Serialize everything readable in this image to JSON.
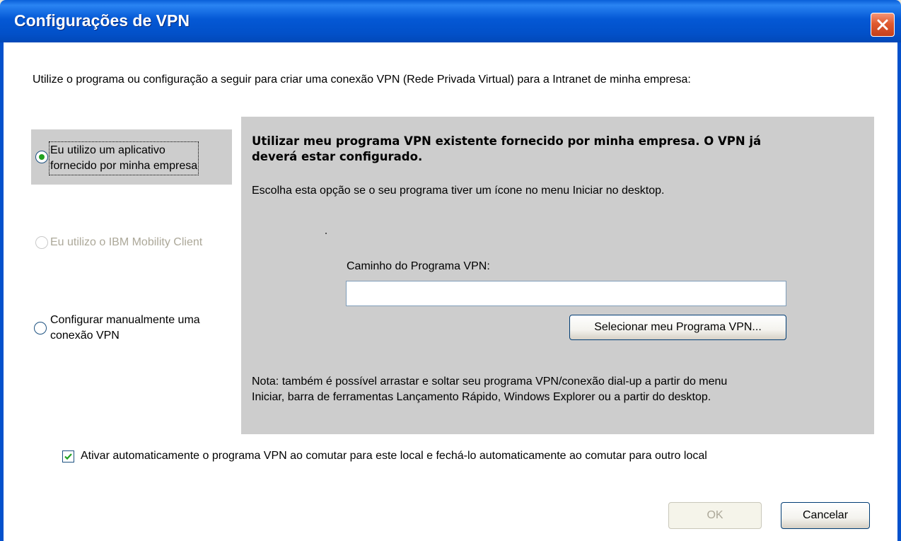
{
  "window": {
    "title": "Configurações de VPN"
  },
  "intro_text": "Utilize o programa ou configuração a seguir para criar uma conexão VPN (Rede Privada Virtual) para a Intranet de minha empresa:",
  "options": [
    {
      "line1": "Eu utilizo um aplicativo",
      "line2": "fornecido por minha empresa",
      "selected": true,
      "enabled": true
    },
    {
      "line1": "Eu utilizo o IBM Mobility Client",
      "line2": "",
      "selected": false,
      "enabled": false
    },
    {
      "line1": "Configurar manualmente uma",
      "line2": "conexão VPN",
      "selected": false,
      "enabled": true
    }
  ],
  "panel": {
    "heading_line1": "Utilizar meu programa VPN existente fornecido por minha empresa.  O VPN já",
    "heading_line2": "deverá estar configurado.",
    "description": "Escolha esta opção se o seu programa tiver um ícone no menu Iniciar no desktop.",
    "path_label": "Caminho do Programa VPN:",
    "path_value": "",
    "select_button": "Selecionar meu Programa VPN...",
    "note_line1": "Nota: também é possível arrastar e soltar seu programa VPN/conexão dial-up a partir do menu",
    "note_line2": "Iniciar, barra de ferramentas Lançamento Rápido, Windows Explorer ou a partir do desktop."
  },
  "auto_activate": {
    "checked": true,
    "label": "Ativar automaticamente o programa VPN ao comutar para este local e fechá-lo automaticamente ao comutar para outro local"
  },
  "buttons": {
    "ok": "OK",
    "cancel": "Cancelar"
  }
}
